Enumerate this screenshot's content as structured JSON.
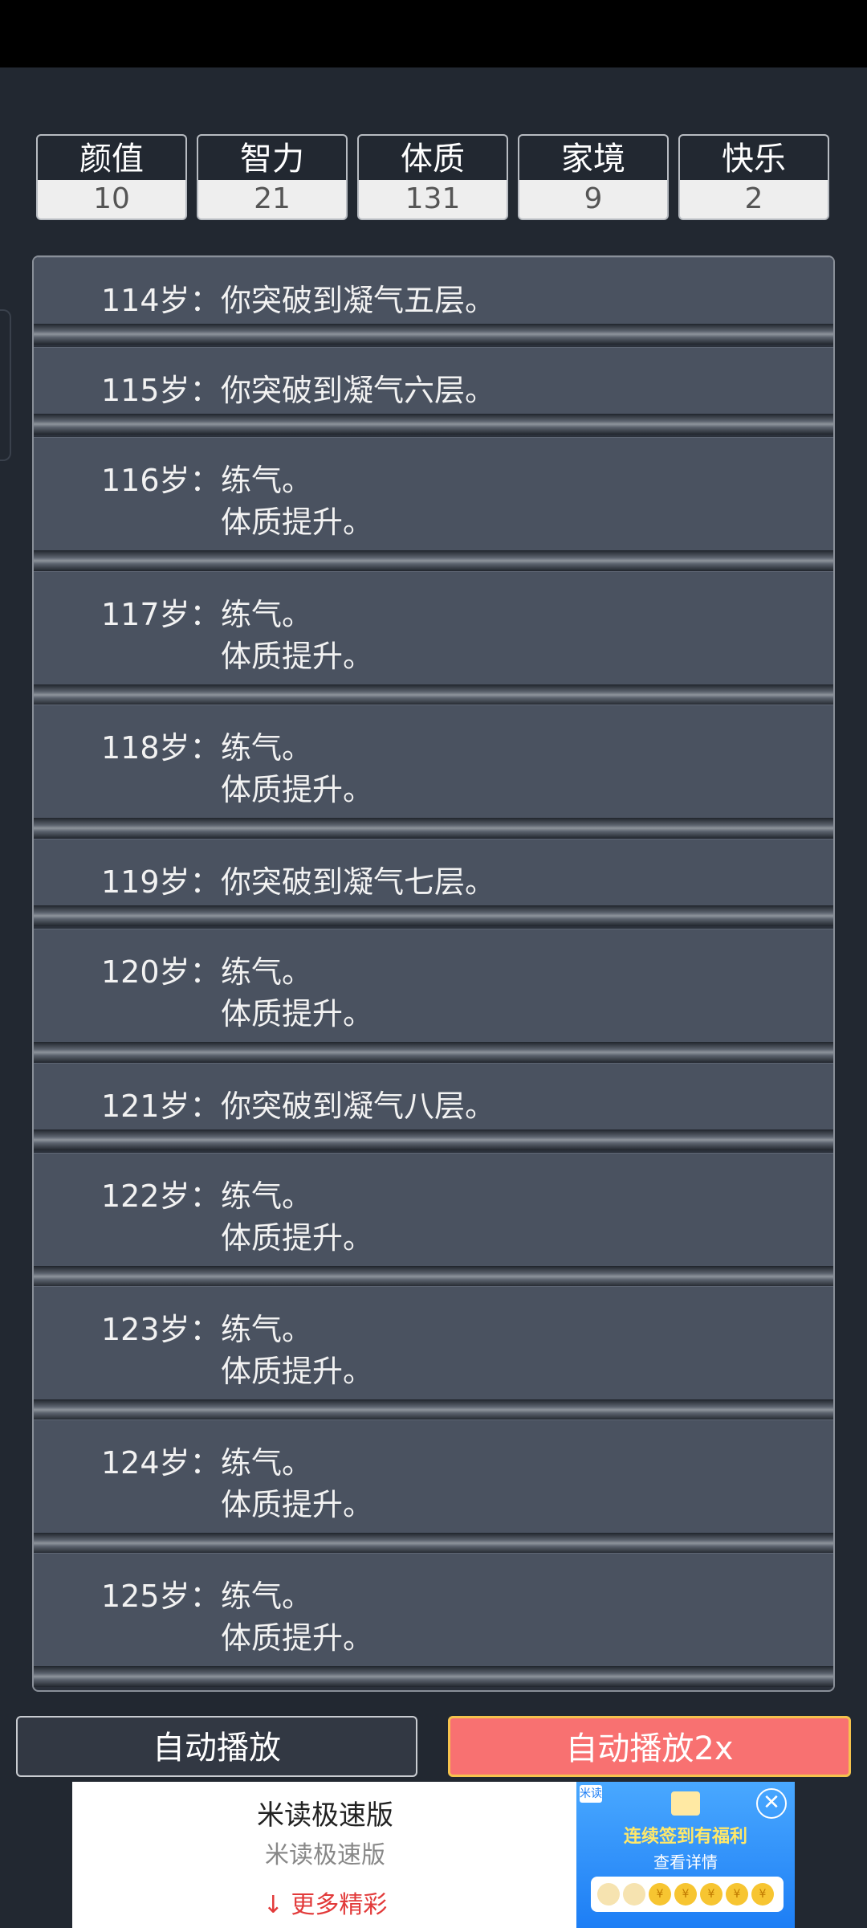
{
  "stats": [
    {
      "label": "颜值",
      "value": "10"
    },
    {
      "label": "智力",
      "value": "21"
    },
    {
      "label": "体质",
      "value": "131"
    },
    {
      "label": "家境",
      "value": "9"
    },
    {
      "label": "快乐",
      "value": "2"
    }
  ],
  "log": [
    {
      "age": "114岁：",
      "lines": [
        "你突破到凝气五层。"
      ]
    },
    {
      "age": "115岁：",
      "lines": [
        "你突破到凝气六层。"
      ]
    },
    {
      "age": "116岁：",
      "lines": [
        "练气。",
        "体质提升。"
      ]
    },
    {
      "age": "117岁：",
      "lines": [
        "练气。",
        "体质提升。"
      ]
    },
    {
      "age": "118岁：",
      "lines": [
        "练气。",
        "体质提升。"
      ]
    },
    {
      "age": "119岁：",
      "lines": [
        "你突破到凝气七层。"
      ]
    },
    {
      "age": "120岁：",
      "lines": [
        "练气。",
        "体质提升。"
      ]
    },
    {
      "age": "121岁：",
      "lines": [
        "你突破到凝气八层。"
      ]
    },
    {
      "age": "122岁：",
      "lines": [
        "练气。",
        "体质提升。"
      ]
    },
    {
      "age": "123岁：",
      "lines": [
        "练气。",
        "体质提升。"
      ]
    },
    {
      "age": "124岁：",
      "lines": [
        "练气。",
        "体质提升。"
      ]
    },
    {
      "age": "125岁：",
      "lines": [
        "练气。",
        "体质提升。"
      ]
    }
  ],
  "buttons": {
    "auto_play": "自动播放",
    "auto_play_2x": "自动播放2x"
  },
  "ad": {
    "title": "米读极速版",
    "subtitle": "米读极速版",
    "more": "↓ 更多精彩",
    "badge": "米读",
    "headline": "连续签到有福利",
    "detail": "查看详情",
    "close_icon": "close-icon",
    "coin_symbol": "¥"
  }
}
